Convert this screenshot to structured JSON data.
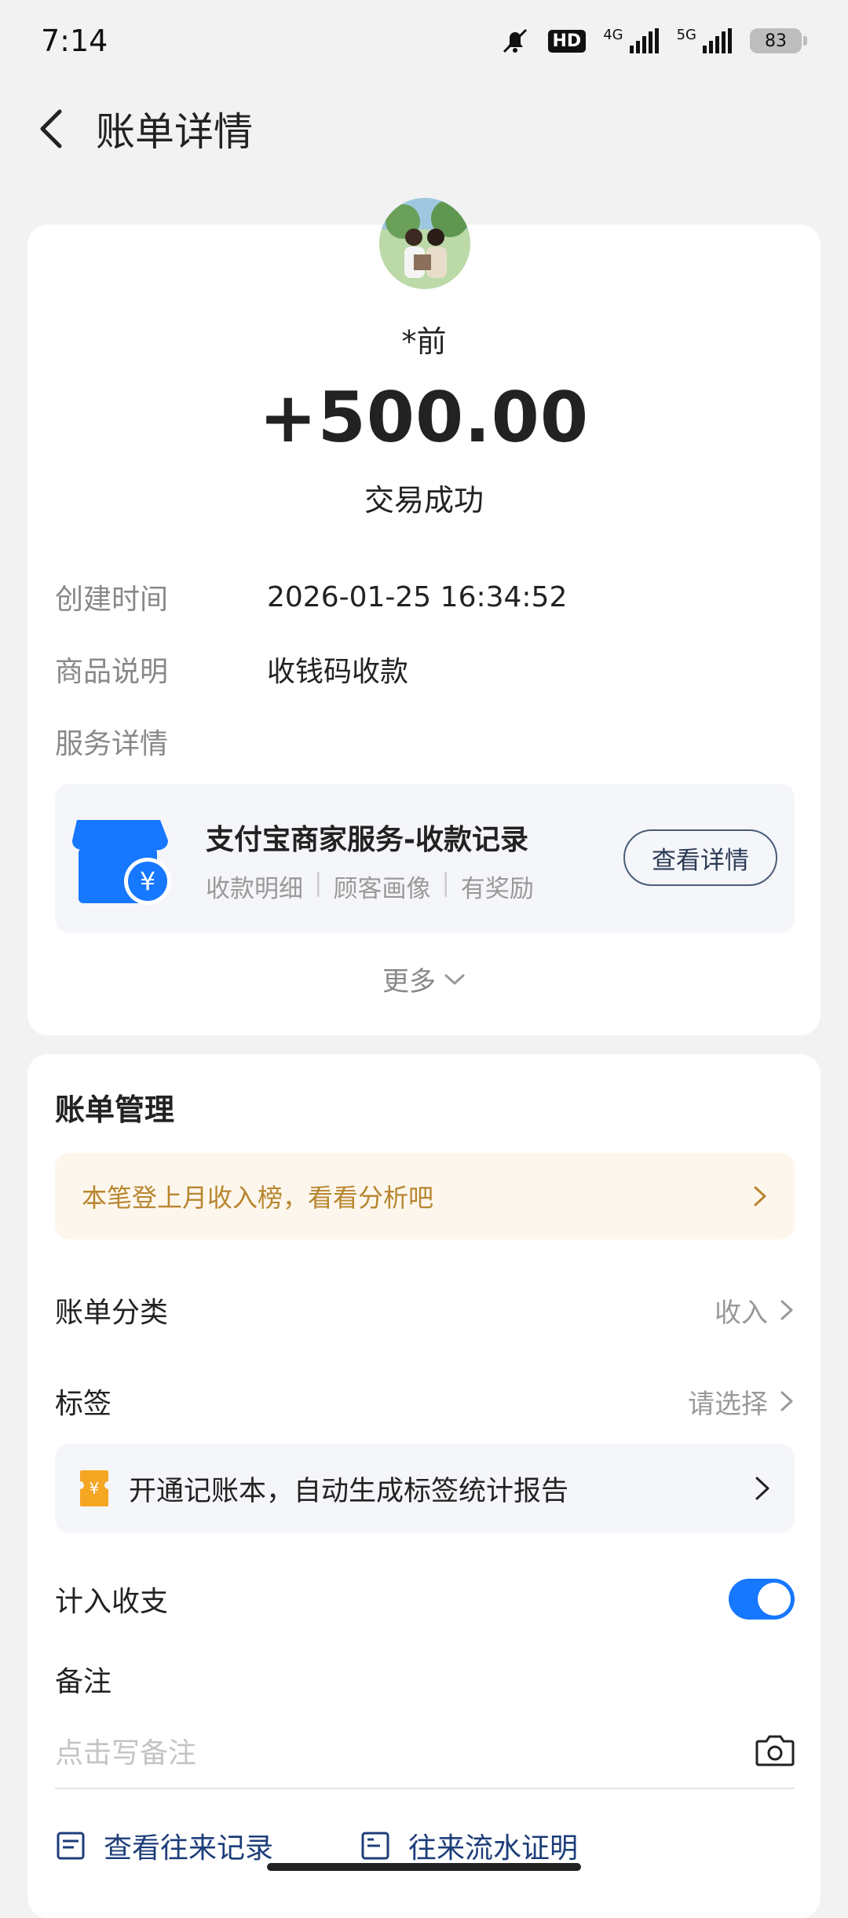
{
  "status_bar": {
    "time": "7:14",
    "hd": "HD",
    "net_4g": "4G",
    "net_5g": "5G",
    "battery": "83"
  },
  "nav": {
    "title": "账单详情"
  },
  "transaction": {
    "payer": "*前",
    "amount": "+500.00",
    "status": "交易成功",
    "created_label": "创建时间",
    "created_value": "2026-01-25 16:34:52",
    "desc_label": "商品说明",
    "desc_value": "收钱码收款",
    "service_label": "服务详情"
  },
  "service": {
    "title": "支付宝商家服务-收款记录",
    "tags": [
      "收款明细",
      "顾客画像",
      "有奖励"
    ],
    "button": "查看详情",
    "icon": "store-yuan-icon"
  },
  "more": {
    "label": "更多"
  },
  "bill_manage": {
    "title": "账单管理",
    "banner": "本笔登上月收入榜，看看分析吧",
    "category_label": "账单分类",
    "category_value": "收入",
    "tag_label": "标签",
    "tag_value": "请选择",
    "promo": "开通记账本，自动生成标签统计报告",
    "include_label": "计入收支",
    "include_on": true,
    "note_label": "备注",
    "note_placeholder": "点击写备注"
  },
  "links": {
    "history": "查看往来记录",
    "proof": "往来流水证明"
  },
  "colors": {
    "accent": "#1677ff",
    "banner_text": "#b8862f",
    "link": "#1d3d7a"
  }
}
